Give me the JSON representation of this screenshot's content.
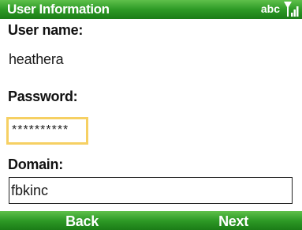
{
  "titlebar": {
    "title": "User Information",
    "input_mode": "abc",
    "signal_icon": "signal-strength-icon"
  },
  "form": {
    "username_label": "User name:",
    "username_value": "heathera",
    "password_label": "Password:",
    "password_value": "**********",
    "domain_label": "Domain:",
    "domain_value": "fbkinc"
  },
  "softkeys": {
    "left": "Back",
    "right": "Next"
  },
  "colors": {
    "bar_green": "#2e9a26",
    "focus_border": "#f6d063"
  }
}
